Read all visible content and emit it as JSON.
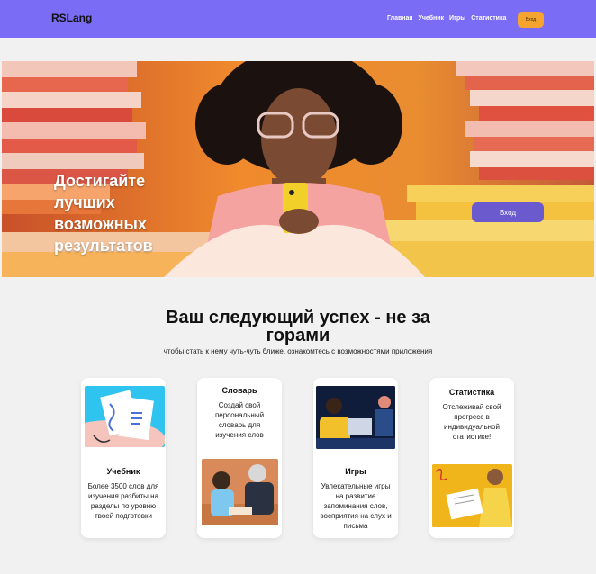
{
  "header": {
    "logo": "RSLang",
    "nav": [
      "Главная",
      "Учебник",
      "Игры",
      "Статистика"
    ],
    "login_label": "Вход",
    "bg_color": "#7b6cf6",
    "accent_color": "#f5a430"
  },
  "hero": {
    "title": "Достигайте лучших возможных результатов",
    "button_label": "Вход"
  },
  "main": {
    "title": "Ваш следующий успех - не за горами",
    "subtitle": "чтобы стать к нему чуть-чуть ближе, ознакомтесь с возможностями приложения"
  },
  "cards": [
    {
      "title": "Учебник",
      "text": "Более 3500 слов для изучения разбиты на разделы по уровню твоей подготовки"
    },
    {
      "title": "Словарь",
      "text": "Создай свой персональный словарь для изучения слов"
    },
    {
      "title": "Игры",
      "text": "Увлекательные игры на развитие запоминания слов, восприятия на слух и письма"
    },
    {
      "title": "Статистика",
      "text": "Отслеживай свой прогресс в индивидуальной статистике!"
    }
  ]
}
